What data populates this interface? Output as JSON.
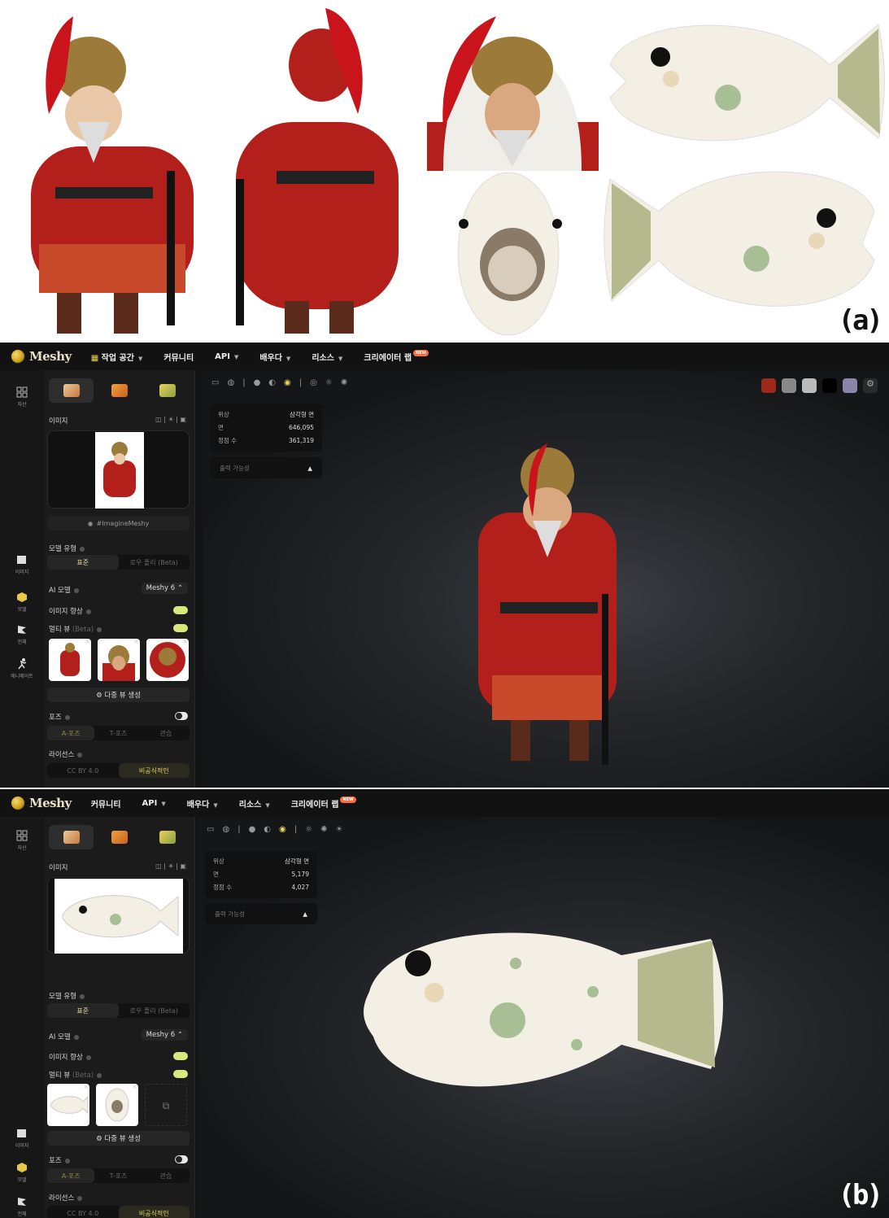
{
  "labels": {
    "a": "(a)",
    "b": "(b)"
  },
  "nav1": {
    "brand": "Meshy",
    "items": [
      "작업 공간",
      "커뮤니티",
      "API",
      "배우다",
      "리소스",
      "크리에이터 랩"
    ],
    "new_badge": "NEW"
  },
  "nav2": {
    "brand": "Meshy",
    "items": [
      "커뮤니티",
      "API",
      "배우다",
      "리소스",
      "크리에이터 랩"
    ],
    "new_badge": "NEW"
  },
  "rail1": [
    "자산",
    "이미지",
    "모델",
    "인체",
    "애니메이트"
  ],
  "rail2": [
    "자산",
    "이미지",
    "모델",
    "인체"
  ],
  "side": {
    "image_label": "이미지",
    "tag": "#ImagineMeshy",
    "model_type": "모델 유형",
    "standard": "표준",
    "low_poly": "로우 폴리 (Beta)",
    "ai_model": "AI 모델",
    "ai_model_value": "Meshy 6 ⌃",
    "enhance": "이미지 향상",
    "multiview": "멀티 뷰",
    "beta": "(Beta)",
    "gen_multiview": "⚙ 다중 뷰 생성",
    "pose": "포즈",
    "a_pose": "A-포즈",
    "t_pose": "T-포즈",
    "custom": "관습",
    "license": "라이선스",
    "cc": "CC BY 4.0",
    "noncommercial": "비공식적인"
  },
  "stats1": {
    "topology": "위상",
    "topology_val": "삼각형 면",
    "faces": "면",
    "faces_val": "646,095",
    "verts": "정점 수",
    "verts_val": "361,319"
  },
  "stats2": {
    "topology": "위상",
    "topology_val": "삼각형 면",
    "faces": "면",
    "faces_val": "5,179",
    "verts": "정점 수",
    "verts_val": "4,027"
  },
  "print_label": "출력 가능성",
  "colors": {
    "bg": "#141414",
    "accent": "#d9e87a",
    "warrior_red": "#b3201c"
  }
}
